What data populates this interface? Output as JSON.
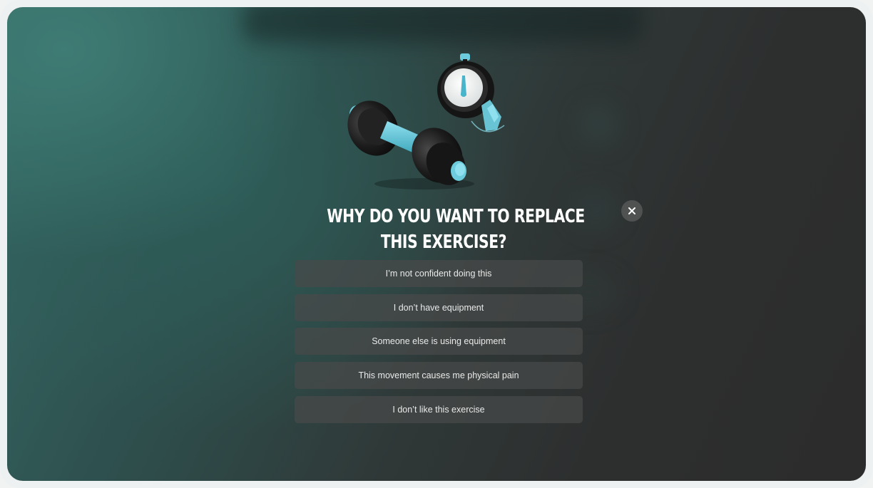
{
  "dialog": {
    "title_line1": "WHY DO YOU WANT TO REPLACE",
    "title_line2": "THIS EXERCISE?",
    "close_icon": "close-icon",
    "illustration": "dumbbell-stopwatch-illustration",
    "options": [
      {
        "label": "I’m not confident doing this"
      },
      {
        "label": "I don’t have equipment"
      },
      {
        "label": "Someone else is using equipment"
      },
      {
        "label": "This movement causes me physical pain"
      },
      {
        "label": "I don’t like this exercise"
      }
    ]
  },
  "colors": {
    "accent": "#5ec3d6",
    "background_teal": "#356a66",
    "background_dark": "#2c2c2c",
    "option_bg": "#484a4a",
    "close_bg": "#505252"
  }
}
